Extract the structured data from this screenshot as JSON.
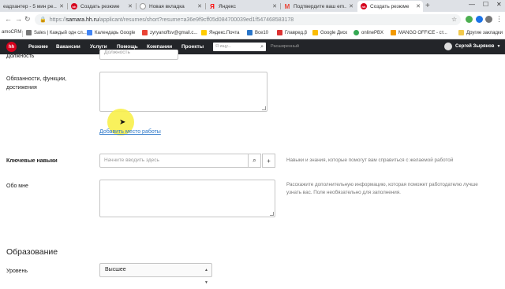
{
  "browser": {
    "tabs": [
      {
        "label": "еадхантер - 5 мин ре...",
        "color": "#4285f4",
        "glyph": ""
      },
      {
        "label": "Создать резюме",
        "color": "#d6001c",
        "glyph": "hh"
      },
      {
        "label": "Новая вкладка",
        "color": "#ffffff",
        "glyph": ""
      },
      {
        "label": "Яндекс",
        "color": "#ff0000",
        "glyph": "Я"
      },
      {
        "label": "Подтвердите ваш em...",
        "color": "#ea4335",
        "glyph": "M"
      },
      {
        "label": "Создать резюме",
        "color": "#d6001c",
        "glyph": "hh",
        "active": true
      }
    ],
    "url_host": "samara.hh.ru",
    "url_path": "/applicant/resumes/short?resume=a36e9f9cff05d084700039ed1f547468583178",
    "url_scheme": "https://"
  },
  "bookmarks": [
    {
      "label": "amoCRM",
      "color": "#4c8bf5"
    },
    {
      "label": "Sales | Каждый одн сл...",
      "color": "#777"
    },
    {
      "label": "Календарь Google",
      "color": "#4285f4"
    },
    {
      "label": "zyryanoffsv@gmail.c...",
      "color": "#ea4335"
    },
    {
      "label": "Яндекс.Почта",
      "color": "#ffcc00"
    },
    {
      "label": "Все10",
      "color": "#2a76c9"
    },
    {
      "label": "Главред.β",
      "color": "#d33"
    },
    {
      "label": "Google Диск",
      "color": "#fbbc04"
    },
    {
      "label": "onlinePBX",
      "color": "#34a853"
    },
    {
      "label": "MANGO OFFICE - ст...",
      "color": "#f29900"
    },
    {
      "label": "Другие закладки",
      "color": "#f2c94c"
    }
  ],
  "hh_nav": {
    "logo": "hh",
    "links": [
      "Резюме",
      "Вакансии",
      "Услуги",
      "Помощь",
      "Компании",
      "Проекты"
    ],
    "search_placeholder": "Я ищу...",
    "advanced": "Расширенный",
    "user_name": "Сергей Зырянов"
  },
  "form": {
    "position_label": "Должность",
    "position_placeholder": "Должность",
    "duties_label": "Обязанности, функции, достижения",
    "add_workplace": "Добавить место работы",
    "skills_label": "Ключевые навыки",
    "skills_placeholder": "Начните вводить здесь",
    "skills_hint": "Навыки и знания, которые помогут вам справиться с желаемой работой",
    "about_label": "Обо мне",
    "about_hint": "Расскажите дополнительную информацию, которая поможет работодателю лучше узнать вас. Поле необязательно для заполнения.",
    "education_title": "Образование",
    "level_label": "Уровень",
    "level_value": "Высшее"
  }
}
